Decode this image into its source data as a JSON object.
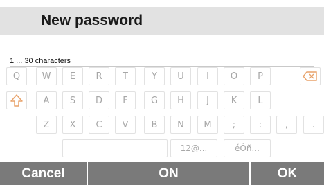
{
  "header": {
    "title": "New password"
  },
  "field": {
    "hint": "1 ... 30 characters"
  },
  "keyboard": {
    "row1": [
      "Q",
      "W",
      "E",
      "R",
      "T",
      "Y",
      "U",
      "I",
      "O",
      "P"
    ],
    "row2": [
      "A",
      "S",
      "D",
      "F",
      "G",
      "H",
      "J",
      "K",
      "L"
    ],
    "row3": [
      "Z",
      "X",
      "C",
      "V",
      "B",
      "N",
      "M",
      ";",
      ":",
      ",",
      "."
    ],
    "row4": {
      "symbols": "12@...",
      "accents": "éÕñ..."
    },
    "icons": {
      "backspace": "backspace-icon",
      "shift": "shift-icon"
    },
    "colors": {
      "icon": "#e8a26a",
      "key_text": "#a7a7a7"
    }
  },
  "footer": {
    "cancel": "Cancel",
    "on": "ON",
    "ok": "OK"
  }
}
